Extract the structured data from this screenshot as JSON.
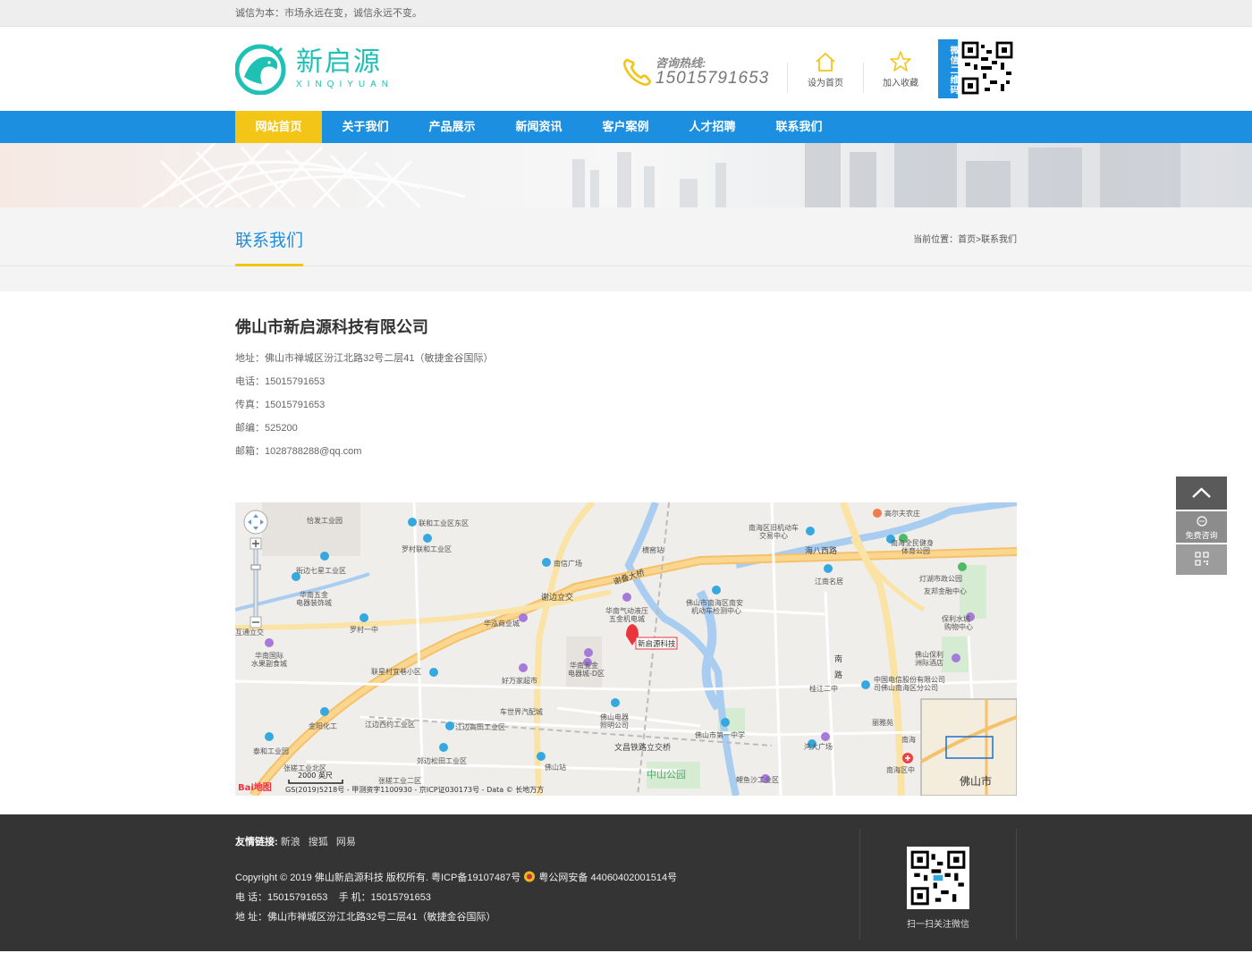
{
  "topbar": {
    "slogan": "诚信为本：市场永远在变，诚信永远不变。"
  },
  "header": {
    "logo_cn": "新启源",
    "logo_en": "XINQIYUAN",
    "hotline_label": "咨询热线:",
    "hotline_number": "15015791653",
    "set_home": "设为首页",
    "add_fav": "加入收藏",
    "wechat_tag": "微信二维码"
  },
  "nav": {
    "items": [
      {
        "label": "网站首页"
      },
      {
        "label": "关于我们"
      },
      {
        "label": "产品展示"
      },
      {
        "label": "新闻资讯"
      },
      {
        "label": "客户案例"
      },
      {
        "label": "人才招聘"
      },
      {
        "label": "联系我们"
      }
    ]
  },
  "page": {
    "title": "联系我们",
    "crumbs_prefix": "当前位置：",
    "crumbs_home": "首页",
    "crumbs_sep": ">",
    "crumbs_current": "联系我们"
  },
  "contact": {
    "company": "佛山市新启源科技有限公司",
    "address": "地址：佛山市禅城区汾江北路32号二层41（敏捷金谷国际）",
    "phone": "电话：15015791653",
    "fax": "传真：15015791653",
    "postcode": "邮编：525200",
    "email": "邮箱：1028788288@qq.com"
  },
  "map": {
    "marker_label": "新启源科技",
    "scale_label": "2000 英尺",
    "copyright": "GS(2019)5218号 - 甲测资字1100930 - 京ICP证030173号 - Data © 长地万方",
    "baidu_logo": "Bai地图",
    "road_labels": [
      "谢叠大桥",
      "海八西路",
      "南一路",
      "文昌铁路立交桥",
      "谢边立交",
      "互通立交"
    ],
    "place_labels": [
      "恰发工业园",
      "联和工业区东区",
      "罗村联和工业区",
      "横窖站",
      "南区旧机动车交易中心",
      "高尔夫农庄",
      "南海全民健身体育公园",
      "灯湖市政公园",
      "友邦金融中心",
      "保利水城购物中心",
      "江南名居",
      "佛山市南海区南安机动车检测中心",
      "南信广场",
      "街边七星工业区",
      "华南五金电器装饰城",
      "罗村一中",
      "华泓商业城",
      "华南气动液压五金机电城",
      "华南国际水果副食城",
      "联星村宜巷小区",
      "好万家超市",
      "华南五金电器城-D区",
      "车世界汽配城",
      "佛山保利洲际酒店",
      "中国电信股份有限公司佛山南海区分公司",
      "桂江二中",
      "金阳化工",
      "江边西约工业区",
      "江边高田工业区",
      "佛山电器照明公司",
      "佛山市第一中学",
      "丽雅苑",
      "泰和工业园",
      "郊边松田工业区",
      "鸿大广场",
      "张槎工业北区",
      "张槎工业二区",
      "佛山站",
      "中山公园",
      "鲤鱼沙工业区",
      "南海区中",
      "佛山市"
    ]
  },
  "footer": {
    "friends_label": "友情链接:",
    "friends": [
      "新浪",
      "搜狐",
      "网易"
    ],
    "copyright": "Copyright © 2019 佛山新启源科技 版权所有. 粤ICP备19107487号",
    "police": "粤公网安备 44060402001514号",
    "phone_line": "电 话：15015791653    手 机：15015791653",
    "address_line": "地 址：佛山市禅城区汾江北路32号二层41（敏捷金谷国际）",
    "qr_caption": "扫一扫关注微信"
  },
  "side": {
    "consult_label": "免费咨询"
  },
  "colors": {
    "primary": "#1c8fe0",
    "accent": "#f3c517",
    "logo": "#1fc1b5",
    "footer_bg": "#343434"
  }
}
